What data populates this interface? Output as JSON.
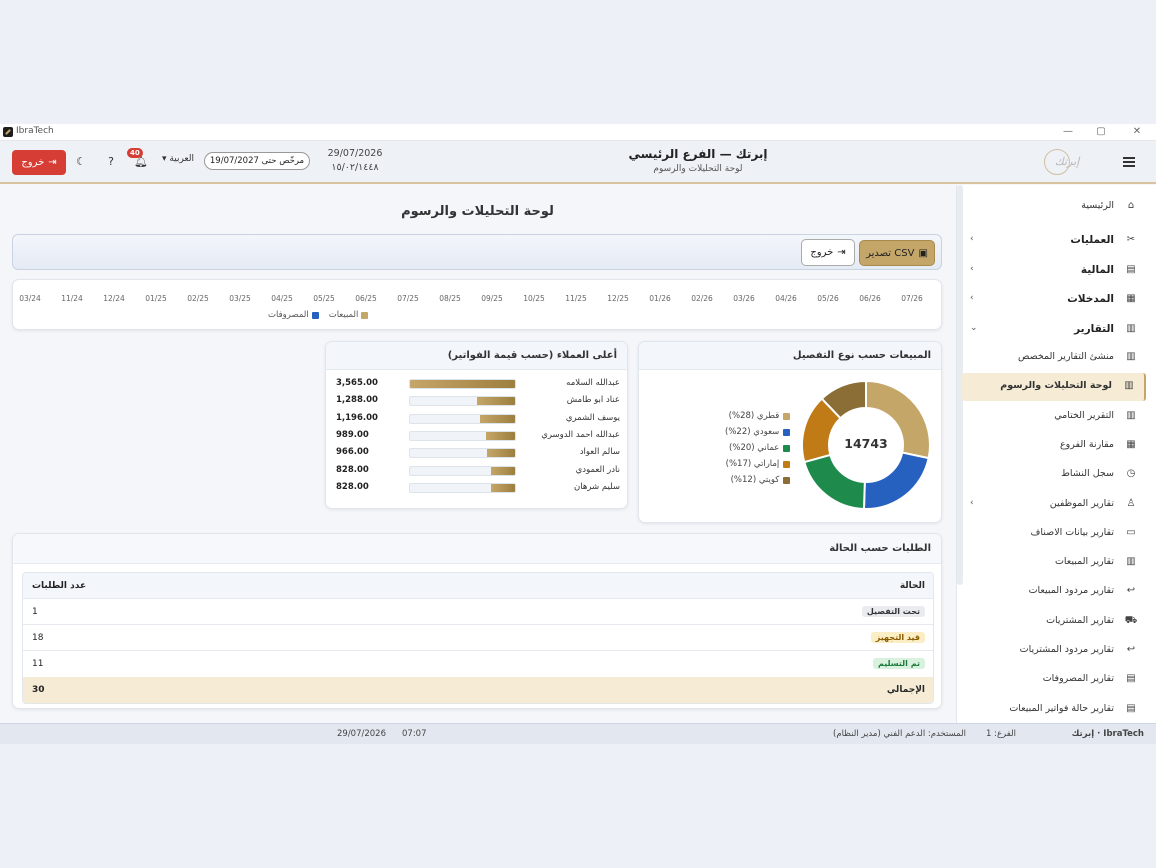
{
  "window": {
    "app_name": "IbraTech",
    "controls": {
      "minimize": "—",
      "maximize": "▢",
      "close": "✕"
    }
  },
  "header": {
    "logout_label": "خروج",
    "notifications_count": "40",
    "language": "العربية",
    "branch_pill": "مرخّص حتى 19/07/2027",
    "date_gregorian": "29/07/2026",
    "date_hijri": "١٥/٠٢/١٤٤٨",
    "title": "إبرتك — الفرع الرئيسي",
    "subtitle": "لوحة التحليلات والرسوم",
    "logo_text": "إبرتك"
  },
  "page": {
    "title": "لوحة التحليلات والرسوم",
    "export_csv": "تصدير CSV",
    "exit": "خروج"
  },
  "timeline": {
    "ticks": [
      "03/24",
      "11/24",
      "12/24",
      "01/25",
      "02/25",
      "03/25",
      "04/25",
      "05/25",
      "06/25",
      "07/25",
      "08/25",
      "09/25",
      "10/25",
      "11/25",
      "12/25",
      "01/26",
      "02/26",
      "03/26",
      "04/26",
      "05/26",
      "06/26",
      "07/26"
    ],
    "legend": [
      {
        "name": "المصروفات",
        "color": "#2761bf"
      },
      {
        "name": "المبيعات",
        "color": "#c5a669"
      }
    ]
  },
  "sales_by_type": {
    "title": "المبيعات حسب نوع التفصيل",
    "total": "14743",
    "slices": [
      {
        "label": "قطري",
        "pct": "(28%)",
        "value": 28,
        "color": "#c5a669"
      },
      {
        "label": "سعودي",
        "pct": "(22%)",
        "value": 22,
        "color": "#2761bf"
      },
      {
        "label": "عماني",
        "pct": "(20%)",
        "value": 20,
        "color": "#1e8a4c"
      },
      {
        "label": "إماراتي",
        "pct": "(17%)",
        "value": 17,
        "color": "#c07b17"
      },
      {
        "label": "كويتي",
        "pct": "(12%)",
        "value": 12,
        "color": "#8a6e36"
      }
    ]
  },
  "top_customers": {
    "title": "أعلى العملاء (حسب قيمة الفواتير)",
    "rows": [
      {
        "name": "عبدالله السلامه",
        "value": "3,565.00",
        "amount": 3565
      },
      {
        "name": "عناد ابو طامش",
        "value": "1,288.00",
        "amount": 1288
      },
      {
        "name": "يوسف الشمري",
        "value": "1,196.00",
        "amount": 1196
      },
      {
        "name": "عبدالله احمد الدوسري",
        "value": "989.00",
        "amount": 989
      },
      {
        "name": "سالم العواد",
        "value": "966.00",
        "amount": 966
      },
      {
        "name": "نادر العمودي",
        "value": "828.00",
        "amount": 828
      },
      {
        "name": "سليم شرهان",
        "value": "828.00",
        "amount": 828
      }
    ]
  },
  "orders_by_status": {
    "title": "الطلبات حسب الحالة",
    "col_status": "الحالة",
    "col_count": "عدد الطلبات",
    "rows": [
      {
        "status": "تحت التفصيل",
        "count": "1",
        "bg": "#e9ebef",
        "fg": "#333333"
      },
      {
        "status": "قيد التجهيز",
        "count": "18",
        "bg": "#fbeec4",
        "fg": "#8a5a00"
      },
      {
        "status": "تم التسليم",
        "count": "11",
        "bg": "#d9f2df",
        "fg": "#1e7a3c"
      }
    ],
    "total_label": "الإجمالي",
    "total_count": "30"
  },
  "sidebar": {
    "home": "الرئيسية",
    "groups": [
      {
        "label": "العمليات"
      },
      {
        "label": "المالية"
      },
      {
        "label": "المدخلات"
      },
      {
        "label": "التقارير"
      }
    ],
    "report_items": [
      "منشئ التقارير المخصص",
      "لوحة التحليلات والرسوم",
      "التقرير الختامي",
      "مقارنة الفروع",
      "سجل النشاط",
      "تقارير الموظفين",
      "تقارير بيانات الاصناف",
      "تقارير المبيعات",
      "تقارير مردود المبيعات",
      "تقارير المشتريات",
      "تقارير مردود المشتريات",
      "تقارير المصروفات",
      "تقارير حالة فواتير المبيعات"
    ]
  },
  "statusbar": {
    "brand": "إبرتك · IbraTech",
    "branch": "الفرع: 1",
    "user": "المستخدم: الدعم الفني (مدير النظام)",
    "time": "07:07",
    "date": "29/07/2026"
  }
}
